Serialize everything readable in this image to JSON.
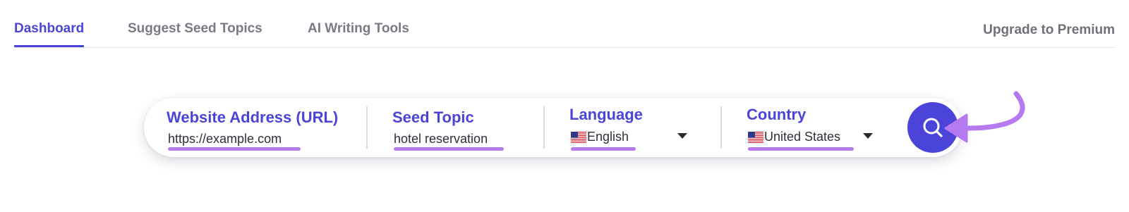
{
  "nav": {
    "tabs": [
      {
        "label": "Dashboard",
        "active": true
      },
      {
        "label": "Suggest Seed Topics",
        "active": false
      },
      {
        "label": "AI Writing Tools",
        "active": false
      }
    ],
    "upgrade_label": "Upgrade to Premium"
  },
  "search": {
    "url": {
      "label": "Website Address (URL)",
      "value": "https://example.com"
    },
    "seed": {
      "label": "Seed Topic",
      "value": "hotel reservation"
    },
    "language": {
      "label": "Language",
      "value": "English",
      "flag": "us-flag-icon"
    },
    "country": {
      "label": "Country",
      "value": "United States",
      "flag": "us-flag-icon"
    },
    "submit_icon": "search-icon"
  },
  "colors": {
    "accent": "#4a45d8",
    "highlight": "#b57af0",
    "tab_inactive": "#7a7a85",
    "divider": "#e2e2e8"
  }
}
